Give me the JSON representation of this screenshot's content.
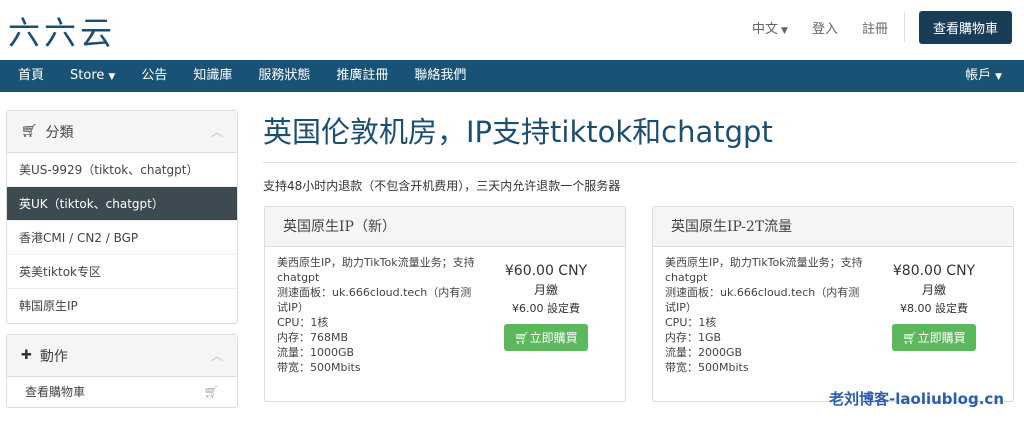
{
  "header": {
    "logo": "六六云",
    "language": "中文",
    "login": "登入",
    "register": "註冊",
    "view_cart": "查看購物車"
  },
  "nav": {
    "items": [
      "首頁",
      "Store",
      "公告",
      "知識庫",
      "服務狀態",
      "推廣註冊",
      "聯絡我們"
    ],
    "account": "帳戶"
  },
  "sidebar": {
    "categories_title": "分類",
    "categories": [
      "美US-9929（tiktok、chatgpt）",
      "英UK（tiktok、chatgpt）",
      "香港CMI / CN2 / BGP",
      "英美tiktok专区",
      "韩国原生IP"
    ],
    "active_index": 1,
    "actions_title": "動作",
    "actions": [
      "查看購物車"
    ]
  },
  "main": {
    "title": "英国伦敦机房，IP支持tiktok和chatgpt",
    "subtitle": "支持48小时内退款（不包含开机费用），三天内允许退款一个服务器",
    "products": [
      {
        "name": "英国原生IP（新）",
        "desc": [
          "美西原生IP，助力TikTok流量业务；支持chatgpt",
          "测速面板：uk.666cloud.tech（内有测试IP）",
          "CPU：1核",
          "内存：768MB",
          "流量：1000GB",
          "带宽：500Mbits"
        ],
        "price": "¥60.00 CNY",
        "cycle": "月繳",
        "setup": "¥6.00 設定費",
        "buy": "立即購買"
      },
      {
        "name": "英国原生IP-2T流量",
        "desc": [
          "美西原生IP，助力TikTok流量业务；支持chatgpt",
          "测速面板：uk.666cloud.tech（内有测试IP）",
          "CPU：1核",
          "内存：1GB",
          "流量：2000GB",
          "带宽：500Mbits"
        ],
        "price": "¥80.00 CNY",
        "cycle": "月繳",
        "setup": "¥8.00 設定費",
        "buy": "立即購買"
      }
    ]
  },
  "watermark": "老刘博客-laoliublog.cn",
  "colors": {
    "brand": "#1a5276",
    "active_item": "#3d4a52",
    "buy_button": "#5cb85c"
  }
}
